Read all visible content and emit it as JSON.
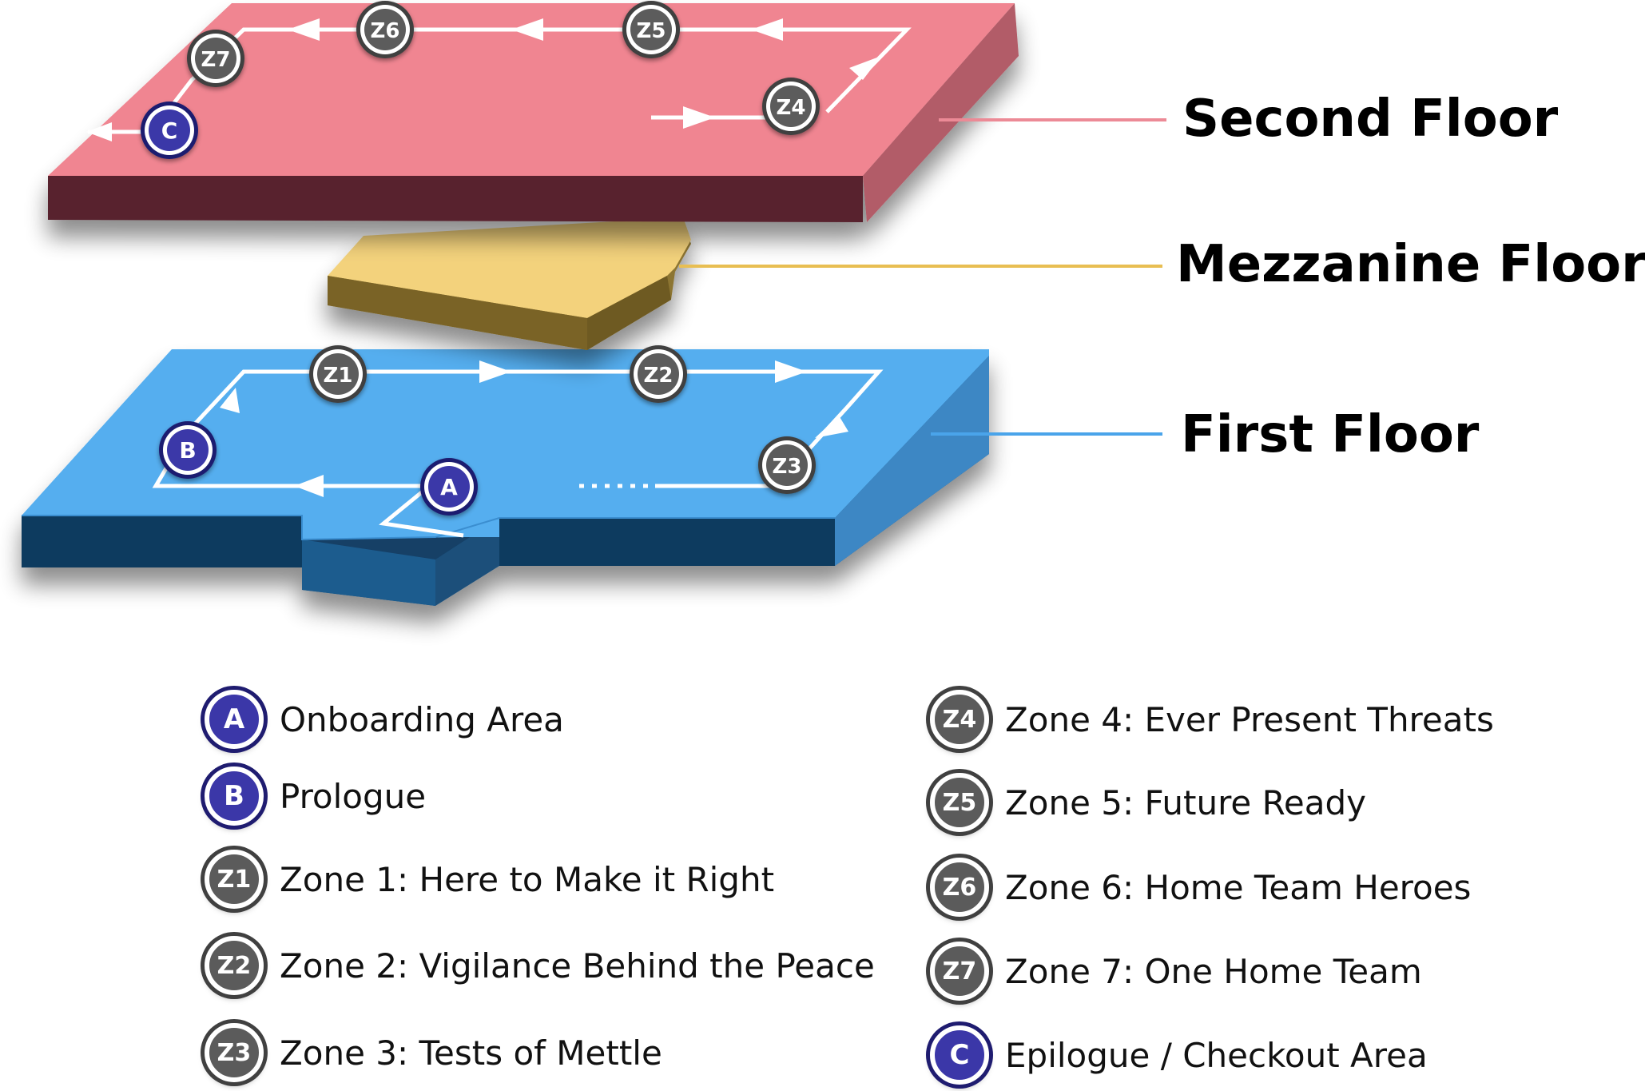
{
  "floors": {
    "second": {
      "label": "Second Floor",
      "color": "#f08591",
      "line_color": "#ec8a96"
    },
    "mezzanine": {
      "label": "Mezzanine Floor",
      "color": "#f3d27c",
      "line_color": "#e8be52"
    },
    "first": {
      "label": "First Floor",
      "color": "#55aeef",
      "line_color": "#4aa4ea"
    }
  },
  "markers": {
    "A": "A",
    "B": "B",
    "C": "C",
    "Z1": "Z1",
    "Z2": "Z2",
    "Z3": "Z3",
    "Z4": "Z4",
    "Z5": "Z5",
    "Z6": "Z6",
    "Z7": "Z7"
  },
  "colors": {
    "zone_badge": "#5b5b5b",
    "point_badge": "#3b37a8",
    "route_line": "#ffffff"
  },
  "legend": {
    "left": [
      {
        "badge": "A",
        "label": "Onboarding Area",
        "kind": "point"
      },
      {
        "badge": "B",
        "label": "Prologue",
        "kind": "point"
      },
      {
        "badge": "Z1",
        "label": "Zone 1: Here to Make it Right",
        "kind": "zone"
      },
      {
        "badge": "Z2",
        "label": "Zone 2: Vigilance Behind the Peace",
        "kind": "zone"
      },
      {
        "badge": "Z3",
        "label": "Zone 3: Tests of Mettle",
        "kind": "zone"
      }
    ],
    "right": [
      {
        "badge": "Z4",
        "label": "Zone 4: Ever Present Threats",
        "kind": "zone"
      },
      {
        "badge": "Z5",
        "label": "Zone 5: Future Ready",
        "kind": "zone"
      },
      {
        "badge": "Z6",
        "label": "Zone 6: Home Team Heroes",
        "kind": "zone"
      },
      {
        "badge": "Z7",
        "label": "Zone 7: One Home Team",
        "kind": "zone"
      },
      {
        "badge": "C",
        "label": "Epilogue / Checkout Area",
        "kind": "point"
      }
    ]
  }
}
